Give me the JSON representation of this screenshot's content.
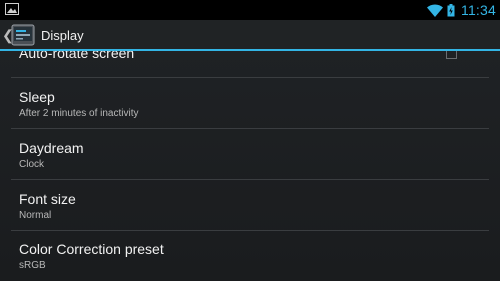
{
  "status_bar": {
    "time": "11:34",
    "icons": [
      "image-notification-icon",
      "wifi-icon",
      "battery-charging-icon"
    ]
  },
  "action_bar": {
    "title": "Display",
    "back_icon": "chevron-left-icon",
    "app_icon": "display-settings-icon"
  },
  "settings": {
    "items": [
      {
        "title": "Auto-rotate screen",
        "summary": "",
        "checked": false
      },
      {
        "title": "Sleep",
        "summary": "After 2 minutes of inactivity"
      },
      {
        "title": "Daydream",
        "summary": "Clock"
      },
      {
        "title": "Font size",
        "summary": "Normal"
      },
      {
        "title": "Color Correction preset",
        "summary": "sRGB"
      }
    ]
  },
  "colors": {
    "accent": "#33b5e5",
    "background": "#1c1e20",
    "text_primary": "#f2f2f2",
    "text_secondary": "#b8b8b8"
  }
}
